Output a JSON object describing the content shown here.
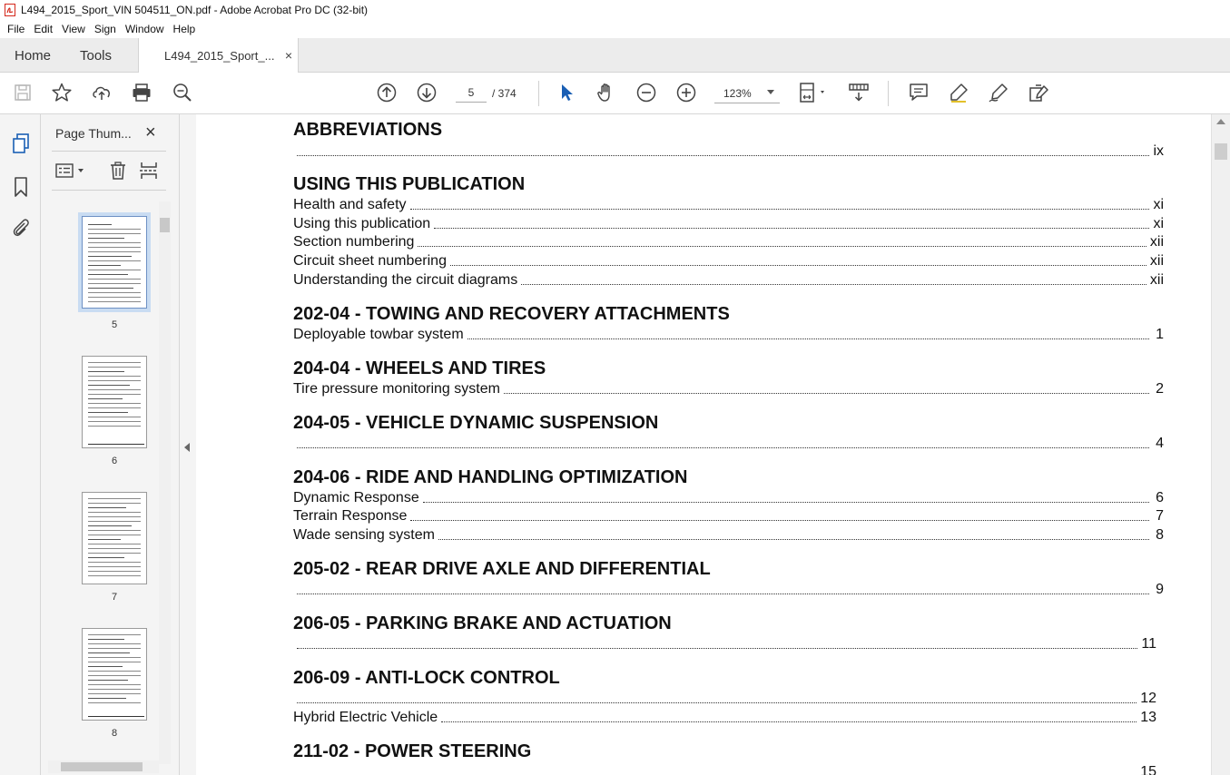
{
  "window": {
    "title": "L494_2015_Sport_VIN 504511_ON.pdf - Adobe Acrobat Pro DC (32-bit)"
  },
  "menu": [
    "File",
    "Edit",
    "View",
    "Sign",
    "Window",
    "Help"
  ],
  "tabs": {
    "home": "Home",
    "tools": "Tools",
    "document": "L494_2015_Sport_...",
    "close_glyph": "×"
  },
  "toolbar": {
    "current_page": "5",
    "total_pages": "/ 374",
    "zoom": "123%"
  },
  "thumbnails": {
    "panel_title": "Page Thum...",
    "close_glyph": "×",
    "pages": [
      "5",
      "6",
      "7",
      "8"
    ]
  },
  "toc": {
    "headings": [
      "ABBREVIATIONS",
      "USING THIS PUBLICATION",
      "202-04 - TOWING AND RECOVERY ATTACHMENTS",
      "204-04 - WHEELS AND TIRES",
      "204-05 - VEHICLE DYNAMIC SUSPENSION",
      "204-06 - RIDE AND HANDLING OPTIMIZATION",
      "205-02 - REAR DRIVE AXLE AND DIFFERENTIAL",
      "206-05 - PARKING BRAKE AND ACTUATION",
      "206-09 - ANTI-LOCK CONTROL",
      "211-02 - POWER STEERING"
    ],
    "entries": [
      {
        "text": "",
        "page": "ix"
      },
      {
        "text": "Health and safety",
        "page": "xi"
      },
      {
        "text": "Using this publication",
        "page": "xi"
      },
      {
        "text": "Section numbering",
        "page": "xii"
      },
      {
        "text": "Circuit sheet numbering",
        "page": "xii"
      },
      {
        "text": "Understanding the circuit diagrams",
        "page": "xii"
      },
      {
        "text": "Deployable towbar system",
        "page": "1"
      },
      {
        "text": "Tire pressure monitoring system",
        "page": "2"
      },
      {
        "text": "",
        "page": "4"
      },
      {
        "text": "Dynamic Response",
        "page": "6"
      },
      {
        "text": "Terrain Response",
        "page": "7"
      },
      {
        "text": "Wade sensing system",
        "page": "8"
      },
      {
        "text": "",
        "page": "9"
      },
      {
        "text": "",
        "page": "11"
      },
      {
        "text": "",
        "page": "12"
      },
      {
        "text": "Hybrid Electric Vehicle",
        "page": "13"
      },
      {
        "text": "",
        "page": "15"
      }
    ]
  },
  "colors": {
    "accent_blue": "#1a5fb4",
    "selected_thumb": "#c9dcf2",
    "acrobat_red": "#d4281b"
  }
}
